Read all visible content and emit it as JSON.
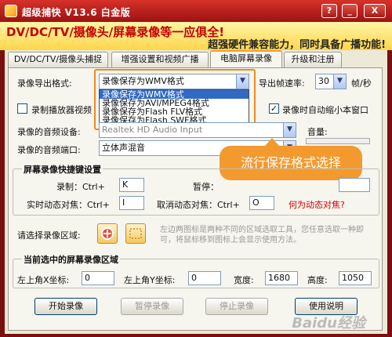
{
  "window": {
    "title": "超级捕快 V13.6 白金版",
    "controls": {
      "help": "?",
      "minimize": "_",
      "close": "X"
    }
  },
  "banner": {
    "line1": "DV/DC/TV/摄像头/屏幕录像等一应俱全!",
    "line2": "超强硬件兼容能力，同时具备广播功能!"
  },
  "tabs": [
    {
      "label": "DV/DC/TV/摄像头捕捉"
    },
    {
      "label": "增强设置和视频广播"
    },
    {
      "label": "电脑屏幕录像"
    },
    {
      "label": "升级和注册"
    }
  ],
  "export": {
    "label": "录像导出格式:",
    "selected": "录像保存为WMV格式",
    "options": [
      "录像保存为WMV格式",
      "录像保存为AVI/MPEG4格式",
      "录像保存为Flash FLV格式",
      "录像保存为Flash SWF格式"
    ],
    "fps_label": "导出帧速率:",
    "fps_value": "30",
    "fps_unit": "帧/秒"
  },
  "options": {
    "record_player_label": "录制播放器视频",
    "record_player_checked": false,
    "auto_minimize_label": "录像时自动缩小本窗口",
    "auto_minimize_checked": true
  },
  "audio": {
    "device_label": "录像的音频设备:",
    "device_value": "Realtek HD Audio Input",
    "port_label": "录像的音频端口:",
    "port_value": "立体声混音",
    "volume_label": "音量:"
  },
  "callout": {
    "text": "流行保存格式选择"
  },
  "hotkeys": {
    "title": "屏幕录像快捷键设置",
    "record_label": "录制：Ctrl+",
    "record_key": "K",
    "pause_label": "暂停：",
    "pause_key": "",
    "track_label": "实时动态对焦：Ctrl+",
    "track_key": "I",
    "cancel_track_label": "取消动态对焦：Ctrl+",
    "cancel_track_key": "O",
    "help_link": "何为动态对焦?"
  },
  "region": {
    "label": "请选择录像区域:",
    "hint": "左边两图标是两种不同的区域选取工具，您任意选取一种即可，将鼠标移到图标上会显示使用方法。"
  },
  "current_region": {
    "title": "当前选中的屏幕录像区域",
    "left_x_label": "左上角X坐标:",
    "left_x_value": "0",
    "left_y_label": "左上角Y坐标:",
    "left_y_value": "0",
    "width_label": "宽度:",
    "width_value": "1680",
    "height_label": "高度:",
    "height_value": "1050"
  },
  "actions": {
    "start": "开始录像",
    "pause": "暂停录像",
    "stop": "停止录像",
    "help": "使用说明"
  },
  "watermark": "Baidu经验",
  "colors": {
    "title_red": "#b01a14",
    "banner_yellow": "#ffe36a",
    "accent_orange": "#f39a2e",
    "link_red": "#d00000"
  }
}
